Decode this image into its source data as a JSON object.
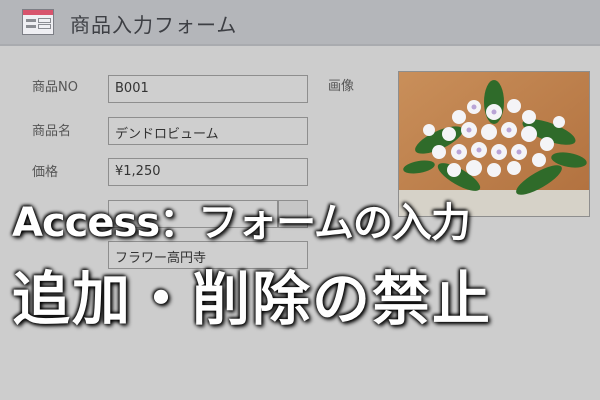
{
  "window": {
    "title": "商品入力フォーム",
    "icon": "form-icon"
  },
  "form": {
    "fields": [
      {
        "label": "商品NO",
        "value": "B001"
      },
      {
        "label": "商品名",
        "value": "デンドロビューム"
      },
      {
        "label": "価格",
        "value": "¥1,250"
      },
      {
        "label": "",
        "value": ""
      },
      {
        "label": "",
        "value": "フラワー高円寺"
      }
    ],
    "image_label": "画像"
  },
  "overlay": {
    "line1": "Access：フォームの入力",
    "line2": "追加・削除の禁止"
  },
  "colors": {
    "background": "#cdcdcd",
    "titlebar": "#b4b6ba",
    "overlay_text": "#ffffff"
  }
}
